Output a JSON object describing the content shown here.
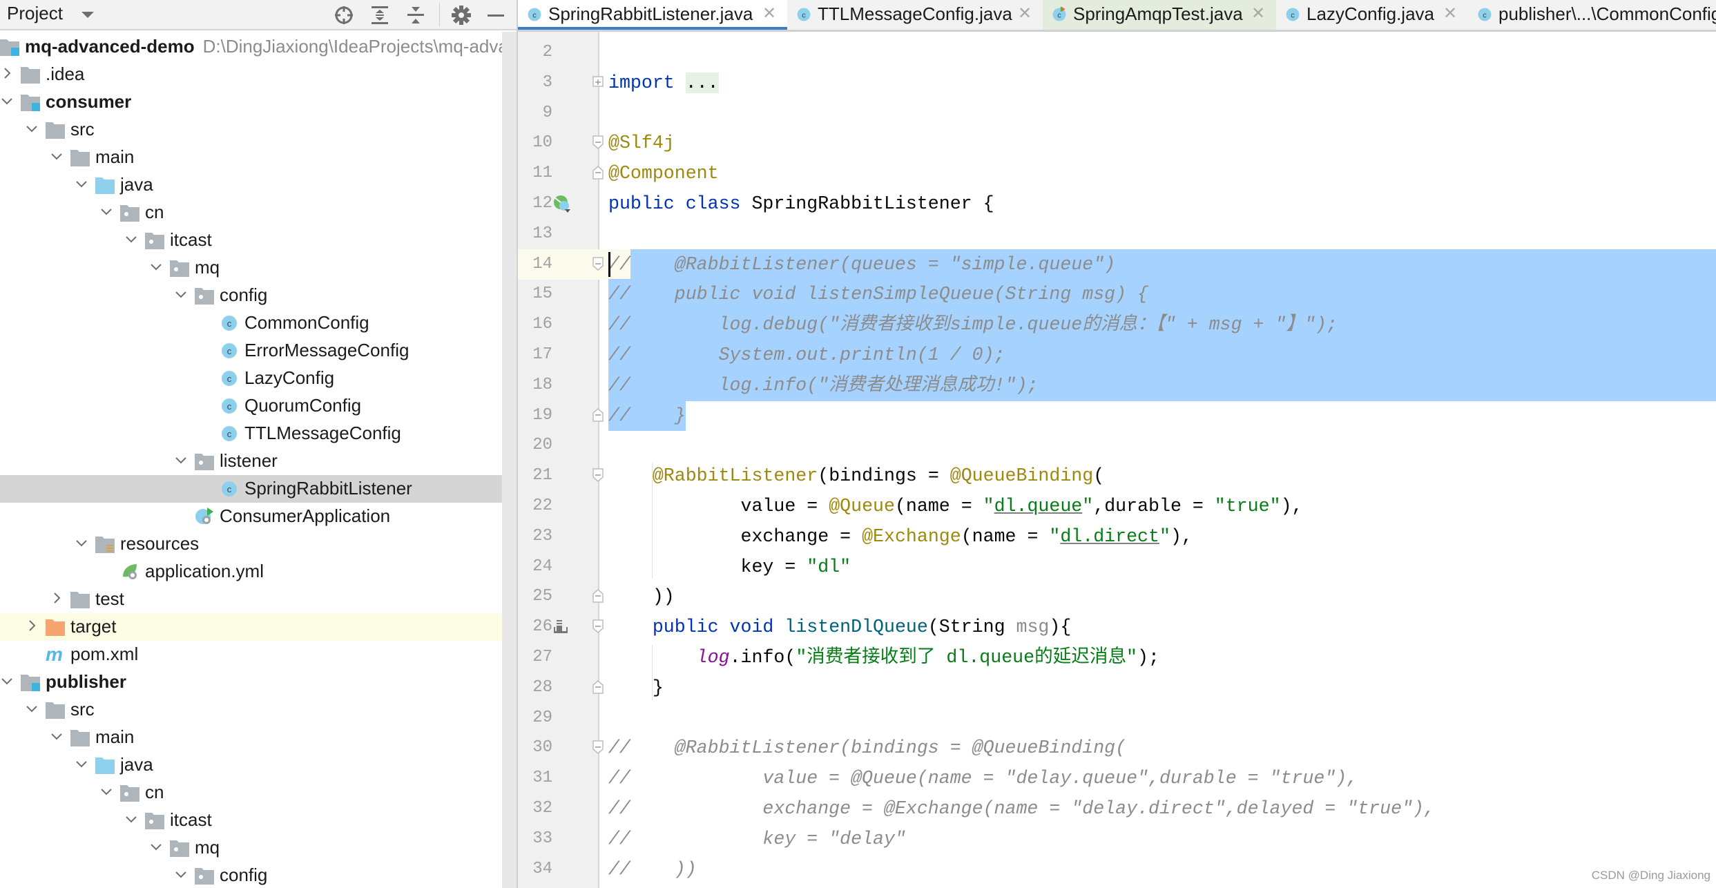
{
  "sidebar": {
    "title": "Project",
    "toolbar_icons": [
      "locate-icon",
      "expand-all-icon",
      "collapse-all-icon",
      "gear-icon",
      "hide-icon"
    ],
    "tree": [
      {
        "label": "mq-advanced-demo",
        "path": "D:\\DingJiaxiong\\IdeaProjects\\mq-advanced-demo",
        "level": 0,
        "icon": "module-folder",
        "arrow": "none",
        "bold": true
      },
      {
        "label": ".idea",
        "level": 1,
        "icon": "folder",
        "arrow": "collapsed"
      },
      {
        "label": "consumer",
        "level": 1,
        "icon": "module-folder",
        "arrow": "expanded",
        "bold": true
      },
      {
        "label": "src",
        "level": 2,
        "icon": "folder",
        "arrow": "expanded"
      },
      {
        "label": "main",
        "level": 3,
        "icon": "folder",
        "arrow": "expanded"
      },
      {
        "label": "java",
        "level": 4,
        "icon": "source-folder",
        "arrow": "expanded"
      },
      {
        "label": "cn",
        "level": 5,
        "icon": "package",
        "arrow": "expanded"
      },
      {
        "label": "itcast",
        "level": 6,
        "icon": "package",
        "arrow": "expanded"
      },
      {
        "label": "mq",
        "level": 7,
        "icon": "package",
        "arrow": "expanded"
      },
      {
        "label": "config",
        "level": 8,
        "icon": "package",
        "arrow": "expanded"
      },
      {
        "label": "CommonConfig",
        "level": 9,
        "icon": "class"
      },
      {
        "label": "ErrorMessageConfig",
        "level": 9,
        "icon": "class"
      },
      {
        "label": "LazyConfig",
        "level": 9,
        "icon": "class"
      },
      {
        "label": "QuorumConfig",
        "level": 9,
        "icon": "class"
      },
      {
        "label": "TTLMessageConfig",
        "level": 9,
        "icon": "class"
      },
      {
        "label": "listener",
        "level": 8,
        "icon": "package",
        "arrow": "expanded"
      },
      {
        "label": "SpringRabbitListener",
        "level": 9,
        "icon": "class",
        "selected": true
      },
      {
        "label": "ConsumerApplication",
        "level": 8,
        "icon": "spring-boot-class"
      },
      {
        "label": "resources",
        "level": 4,
        "icon": "resources-folder",
        "arrow": "expanded"
      },
      {
        "label": "application.yml",
        "level": 5,
        "icon": "spring-yml"
      },
      {
        "label": "test",
        "level": 3,
        "icon": "folder",
        "arrow": "collapsed"
      },
      {
        "label": "target",
        "level": 2,
        "icon": "excluded-folder",
        "arrow": "collapsed",
        "highlighted": true
      },
      {
        "label": "pom.xml",
        "level": 2,
        "icon": "maven"
      },
      {
        "label": "publisher",
        "level": 1,
        "icon": "module-folder",
        "arrow": "expanded",
        "bold": true
      },
      {
        "label": "src",
        "level": 2,
        "icon": "folder",
        "arrow": "expanded"
      },
      {
        "label": "main",
        "level": 3,
        "icon": "folder",
        "arrow": "expanded"
      },
      {
        "label": "java",
        "level": 4,
        "icon": "source-folder",
        "arrow": "expanded"
      },
      {
        "label": "cn",
        "level": 5,
        "icon": "package",
        "arrow": "expanded"
      },
      {
        "label": "itcast",
        "level": 6,
        "icon": "package",
        "arrow": "expanded"
      },
      {
        "label": "mq",
        "level": 7,
        "icon": "package",
        "arrow": "expanded"
      },
      {
        "label": "config",
        "level": 8,
        "icon": "package",
        "arrow": "expanded"
      }
    ]
  },
  "tabs": [
    {
      "label": "SpringRabbitListener.java",
      "active": true,
      "icon": "class"
    },
    {
      "label": "TTLMessageConfig.java",
      "icon": "class"
    },
    {
      "label": "SpringAmqpTest.java",
      "icon": "test-class",
      "test": true
    },
    {
      "label": "LazyConfig.java",
      "icon": "class"
    },
    {
      "label": "publisher\\...\\CommonConfig.java",
      "icon": "class"
    }
  ],
  "editor": {
    "caret_line": 14,
    "lines": [
      {
        "n": "2",
        "tokens": []
      },
      {
        "n": "3",
        "fold": "plus",
        "tokens": [
          [
            "kw",
            "import"
          ],
          [
            "",
            " "
          ],
          [
            "imp",
            "..."
          ]
        ]
      },
      {
        "n": "9",
        "tokens": []
      },
      {
        "n": "10",
        "fold": "open",
        "tokens": [
          [
            "an",
            "@Slf4j"
          ]
        ]
      },
      {
        "n": "11",
        "fold": "close",
        "tokens": [
          [
            "an",
            "@Component"
          ]
        ]
      },
      {
        "n": "12",
        "gutter_icon": "spring-bean-icon",
        "tokens": [
          [
            "kw",
            "public class "
          ],
          [
            "",
            "SpringRabbitListener {"
          ]
        ]
      },
      {
        "n": "13",
        "tokens": []
      },
      {
        "n": "14",
        "fold": "open",
        "selected": "partial-start",
        "tokens": [
          [
            "cm",
            "//    @RabbitListener(queues = \"simple.queue\")"
          ]
        ]
      },
      {
        "n": "15",
        "selected": "full",
        "tokens": [
          [
            "cm",
            "//    public void listenSimpleQueue(String msg) {"
          ]
        ]
      },
      {
        "n": "16",
        "selected": "full",
        "tokens": [
          [
            "cm",
            "//        log.debug(\"消费者接收到simple.queue的消息：【\" + msg + \"】\");"
          ]
        ]
      },
      {
        "n": "17",
        "selected": "full",
        "tokens": [
          [
            "cm",
            "//        System.out.println(1 / 0);"
          ]
        ]
      },
      {
        "n": "18",
        "selected": "full",
        "tokens": [
          [
            "cm",
            "//        log.info(\"消费者处理消息成功!\");"
          ]
        ]
      },
      {
        "n": "19",
        "fold": "close",
        "selected": "partial-end",
        "tokens": [
          [
            "cm",
            "//    }"
          ]
        ]
      },
      {
        "n": "20",
        "tokens": []
      },
      {
        "n": "21",
        "fold": "open",
        "tokens": [
          [
            "",
            "    "
          ],
          [
            "an",
            "@RabbitListener"
          ],
          [
            "",
            "(bindings = "
          ],
          [
            "an",
            "@QueueBinding"
          ],
          [
            "",
            "("
          ]
        ]
      },
      {
        "n": "22",
        "tokens": [
          [
            "",
            "            value = "
          ],
          [
            "an",
            "@Queue"
          ],
          [
            "",
            "(name = "
          ],
          [
            "st",
            "\""
          ],
          [
            "st ul",
            "dl.queue"
          ],
          [
            "st",
            "\""
          ],
          [
            "",
            ",durable = "
          ],
          [
            "st",
            "\"true\""
          ],
          [
            "",
            "),"
          ]
        ]
      },
      {
        "n": "23",
        "tokens": [
          [
            "",
            "            exchange = "
          ],
          [
            "an",
            "@Exchange"
          ],
          [
            "",
            "(name = "
          ],
          [
            "st",
            "\""
          ],
          [
            "st ul",
            "dl.direct"
          ],
          [
            "st",
            "\""
          ],
          [
            "",
            "),"
          ]
        ]
      },
      {
        "n": "24",
        "tokens": [
          [
            "",
            "            key = "
          ],
          [
            "st",
            "\"dl\""
          ]
        ]
      },
      {
        "n": "25",
        "fold": "close",
        "tokens": [
          [
            "",
            "    ))"
          ]
        ]
      },
      {
        "n": "26",
        "fold": "open",
        "gutter_icon": "listener-icon",
        "tokens": [
          [
            "",
            "    "
          ],
          [
            "kw",
            "public void "
          ],
          [
            "fn",
            "listenDlQueue"
          ],
          [
            "",
            "(String "
          ],
          [
            "pm",
            "msg"
          ],
          [
            "",
            "){"
          ]
        ]
      },
      {
        "n": "27",
        "tokens": [
          [
            "",
            "        "
          ],
          [
            "sf",
            "log"
          ],
          [
            "",
            ".info("
          ],
          [
            "st",
            "\"消费者接收到了 dl.queue的延迟消息\""
          ],
          [
            "",
            ");"
          ]
        ]
      },
      {
        "n": "28",
        "fold": "close",
        "tokens": [
          [
            "",
            "    }"
          ]
        ]
      },
      {
        "n": "29",
        "tokens": []
      },
      {
        "n": "30",
        "fold": "open",
        "tokens": [
          [
            "cm",
            "//    @RabbitListener(bindings = @QueueBinding("
          ]
        ]
      },
      {
        "n": "31",
        "tokens": [
          [
            "cm",
            "//            value = @Queue(name = \"delay.queue\",durable = \"true\"),"
          ]
        ]
      },
      {
        "n": "32",
        "tokens": [
          [
            "cm",
            "//            exchange = @Exchange(name = \"delay.direct\",delayed = \"true\"),"
          ]
        ]
      },
      {
        "n": "33",
        "tokens": [
          [
            "cm",
            "//            key = \"delay\""
          ]
        ]
      },
      {
        "n": "34",
        "tokens": [
          [
            "cm",
            "//    ))"
          ]
        ]
      }
    ]
  },
  "watermark": "CSDN @Ding Jiaxiong",
  "colors": {
    "selection": "#a6d2ff",
    "keyword": "#0033b3",
    "annotation": "#9e880d",
    "string": "#067d17",
    "comment": "#8c8c8c",
    "active_tab_underline": "#3f7ec6"
  }
}
